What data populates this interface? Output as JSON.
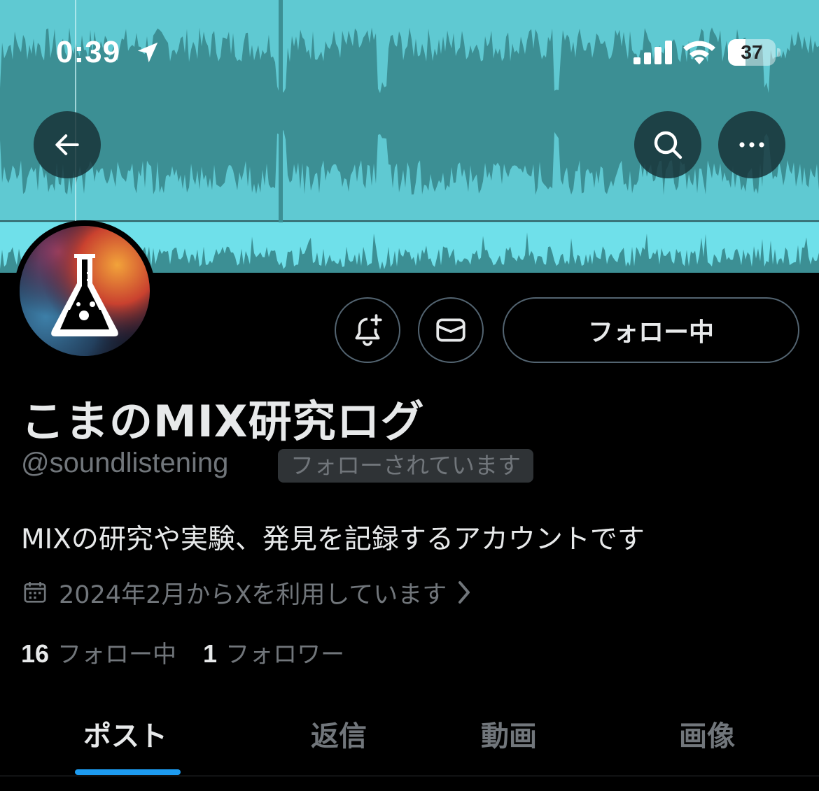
{
  "status_bar": {
    "time": "0:39",
    "battery_level": "37",
    "battery_fraction": 0.37
  },
  "banner": {
    "description_colors": {
      "waveform_bg": "#5ccdd6",
      "waveform_dark": "#3a8a8f"
    }
  },
  "nav": {
    "back_icon": "arrow-left-icon",
    "search_icon": "search-icon",
    "more_icon": "more-horizontal-icon"
  },
  "actions": {
    "notify_icon": "bell-plus-icon",
    "message_icon": "envelope-icon",
    "follow_label": "フォロー中"
  },
  "profile": {
    "display_name": "こまのMIX研究ログ",
    "handle": "@soundlistening",
    "follows_you": "フォローされています",
    "bio": "MIXの研究や実験、発見を記録するアカウントです",
    "joined": "2024年2月からXを利用しています",
    "following_count": "16",
    "following_label": "フォロー中",
    "followers_count": "1",
    "followers_label": "フォロワー"
  },
  "tabs": [
    {
      "label": "ポスト",
      "active": true
    },
    {
      "label": "返信",
      "active": false
    },
    {
      "label": "動画",
      "active": false
    },
    {
      "label": "画像",
      "active": false
    }
  ],
  "colors": {
    "accent": "#1d9bf0",
    "text_primary": "#e7e9ea",
    "text_secondary": "#71767b",
    "border": "#536471",
    "background": "#000000"
  }
}
